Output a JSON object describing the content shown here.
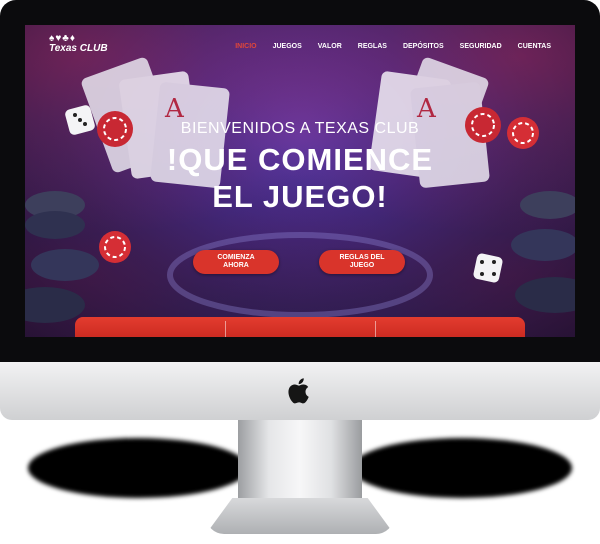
{
  "site": {
    "logo": {
      "suits": "♠♥♣♦",
      "text": "Texas CLUB"
    },
    "nav": [
      {
        "label": "INICIO",
        "active": true
      },
      {
        "label": "JUEGOS",
        "active": false
      },
      {
        "label": "VALOR",
        "active": false
      },
      {
        "label": "REGLAS",
        "active": false
      },
      {
        "label": "DEPÓSITOS",
        "active": false
      },
      {
        "label": "SEGURIDAD",
        "active": false
      },
      {
        "label": "CUENTAS",
        "active": false
      }
    ],
    "hero": {
      "kicker": "BIENVENIDOS A TEXAS CLUB",
      "title_line1": "!QUE COMIENCE",
      "title_line2": "EL JUEGO!"
    },
    "buttons": {
      "start": "COMIENZA AHORA",
      "rules": "REGLAS DEL JUEGO"
    }
  },
  "colors": {
    "accent": "#d9342b",
    "nav_active": "#e0463a",
    "background": "#2b2470"
  },
  "icons": [
    "apple-icon",
    "poker-chip-icon",
    "dice-icon",
    "playing-card-icon"
  ]
}
